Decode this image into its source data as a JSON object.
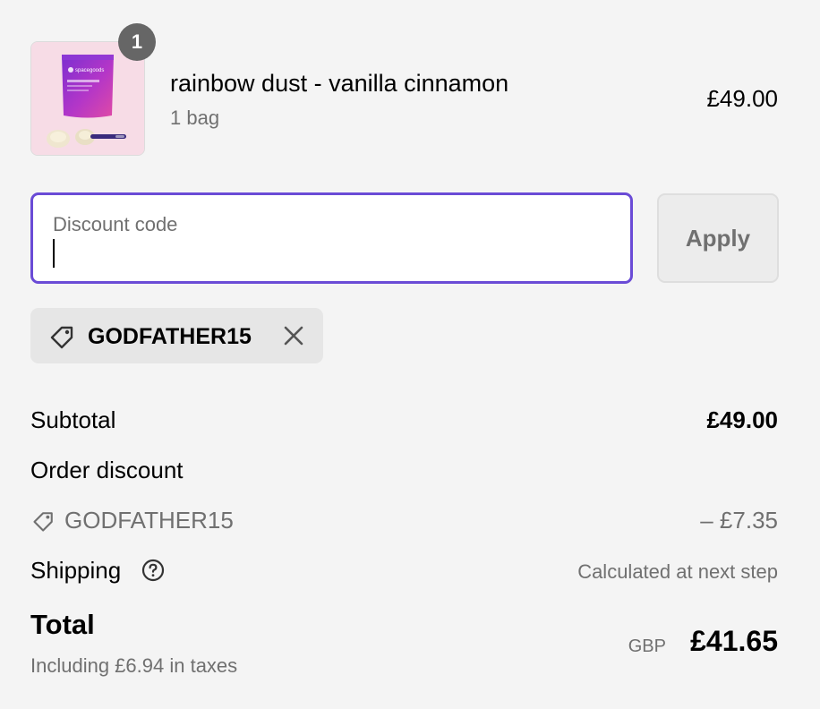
{
  "product": {
    "quantity": "1",
    "name": "rainbow dust - vanilla cinnamon",
    "variant": "1 bag",
    "price": "£49.00",
    "image_text": "spacegoods"
  },
  "discount": {
    "label": "Discount code",
    "value": "",
    "apply_label": "Apply",
    "applied_code": "GODFATHER15"
  },
  "summary": {
    "subtotal_label": "Subtotal",
    "subtotal_value": "£49.00",
    "order_discount_label": "Order discount",
    "discount_code": "GODFATHER15",
    "discount_value": "– £7.35",
    "shipping_label": "Shipping",
    "shipping_value": "Calculated at next step",
    "total_label": "Total",
    "taxes_note": "Including £6.94 in taxes",
    "currency": "GBP",
    "total_value": "£41.65"
  },
  "colors": {
    "accent": "#6a4bd6",
    "background": "#f4f4f4",
    "muted_text": "#707070",
    "badge": "#666666"
  },
  "icons": {
    "tag": "tag-icon",
    "remove": "close-icon",
    "help": "question-circle-icon"
  }
}
